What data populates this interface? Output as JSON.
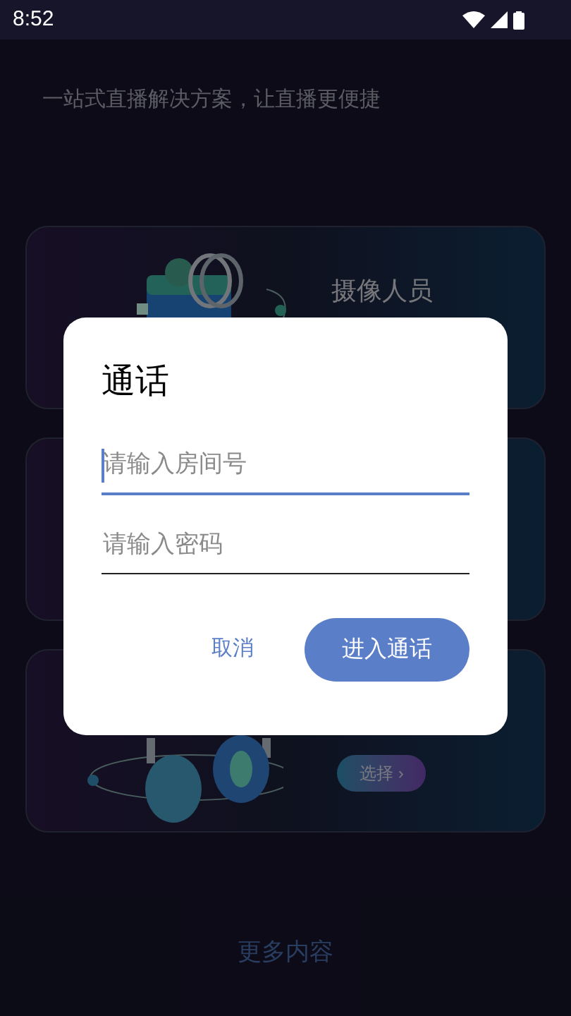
{
  "status_bar": {
    "time": "8:52"
  },
  "subtitle": "一站式直播解决方案，让直播更便捷",
  "cards": [
    {
      "kind": "camera",
      "label": "摄像人员"
    },
    {
      "kind": "blank"
    },
    {
      "kind": "headphones",
      "button": "选择 ›"
    }
  ],
  "more": "更多内容",
  "dialog": {
    "title": "通话",
    "fields": [
      {
        "placeholder": "请输入房间号",
        "focused": true
      },
      {
        "placeholder": "请输入密码",
        "focused": false
      }
    ],
    "cancel": "取消",
    "confirm": "进入通话"
  }
}
